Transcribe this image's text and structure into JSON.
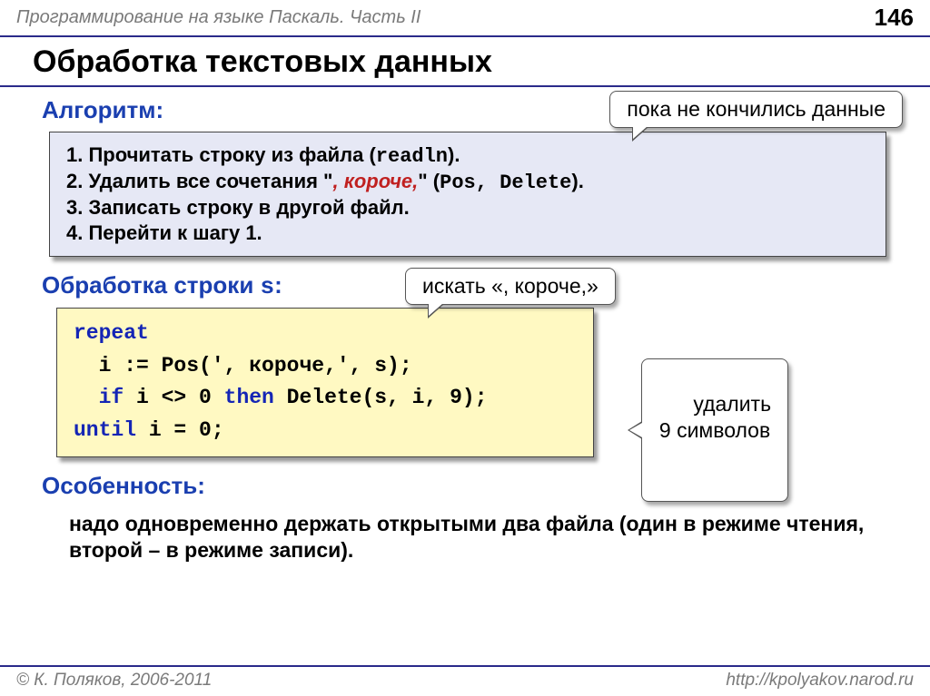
{
  "header": {
    "course": "Программирование на языке Паскаль. Часть II",
    "page": "146"
  },
  "title": "Обработка текстовых данных",
  "callouts": {
    "top": "пока не кончились данные",
    "search": "искать «, короче,»",
    "delete": "удалить\n9 символов"
  },
  "sections": {
    "algo_head": "Алгоритм:",
    "proc_head_a": "Обработка строки ",
    "proc_head_b": "s",
    "proc_head_c": ":",
    "feat_head": "Особенность:"
  },
  "algo": {
    "l1a": "1. Прочитать строку из файла (",
    "l1b": "readln",
    "l1c": ").",
    "l2a": "2. Удалить все сочетания \"",
    "l2b": ", короче,",
    "l2c": "\" (",
    "l2d": "Pos",
    "l2e": ", ",
    "l2f": "Delete",
    "l2g": ").",
    "l3": "3. Записать строку в другой файл.",
    "l4": "4. Перейти к шагу 1."
  },
  "code": {
    "l1": "repeat",
    "l2": "  i := Pos(', короче,', s);",
    "l3a": "  ",
    "l3b": "if",
    "l3c": " i <> 0 ",
    "l3d": "then",
    "l3e": " Delete(s, i, 9);",
    "l4a": "until",
    "l4b": " i = 0;"
  },
  "feature": "надо одновременно держать открытыми два файла (один в режиме чтения, второй – в режиме записи).",
  "footer": {
    "copyright": "© К. Поляков, 2006-2011",
    "url": "http://kpolyakov.narod.ru"
  }
}
